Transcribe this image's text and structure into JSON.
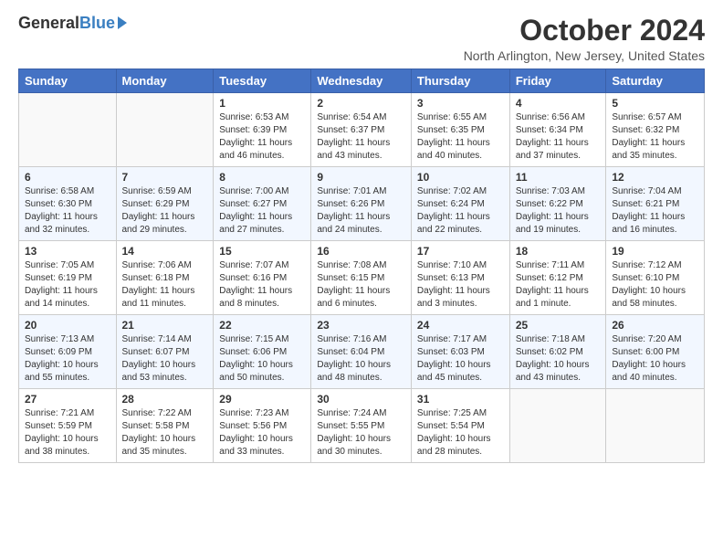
{
  "header": {
    "logo_general": "General",
    "logo_blue": "Blue",
    "title": "October 2024",
    "location": "North Arlington, New Jersey, United States"
  },
  "days_of_week": [
    "Sunday",
    "Monday",
    "Tuesday",
    "Wednesday",
    "Thursday",
    "Friday",
    "Saturday"
  ],
  "weeks": [
    [
      {
        "day": "",
        "info": ""
      },
      {
        "day": "",
        "info": ""
      },
      {
        "day": "1",
        "info": "Sunrise: 6:53 AM\nSunset: 6:39 PM\nDaylight: 11 hours and 46 minutes."
      },
      {
        "day": "2",
        "info": "Sunrise: 6:54 AM\nSunset: 6:37 PM\nDaylight: 11 hours and 43 minutes."
      },
      {
        "day": "3",
        "info": "Sunrise: 6:55 AM\nSunset: 6:35 PM\nDaylight: 11 hours and 40 minutes."
      },
      {
        "day": "4",
        "info": "Sunrise: 6:56 AM\nSunset: 6:34 PM\nDaylight: 11 hours and 37 minutes."
      },
      {
        "day": "5",
        "info": "Sunrise: 6:57 AM\nSunset: 6:32 PM\nDaylight: 11 hours and 35 minutes."
      }
    ],
    [
      {
        "day": "6",
        "info": "Sunrise: 6:58 AM\nSunset: 6:30 PM\nDaylight: 11 hours and 32 minutes."
      },
      {
        "day": "7",
        "info": "Sunrise: 6:59 AM\nSunset: 6:29 PM\nDaylight: 11 hours and 29 minutes."
      },
      {
        "day": "8",
        "info": "Sunrise: 7:00 AM\nSunset: 6:27 PM\nDaylight: 11 hours and 27 minutes."
      },
      {
        "day": "9",
        "info": "Sunrise: 7:01 AM\nSunset: 6:26 PM\nDaylight: 11 hours and 24 minutes."
      },
      {
        "day": "10",
        "info": "Sunrise: 7:02 AM\nSunset: 6:24 PM\nDaylight: 11 hours and 22 minutes."
      },
      {
        "day": "11",
        "info": "Sunrise: 7:03 AM\nSunset: 6:22 PM\nDaylight: 11 hours and 19 minutes."
      },
      {
        "day": "12",
        "info": "Sunrise: 7:04 AM\nSunset: 6:21 PM\nDaylight: 11 hours and 16 minutes."
      }
    ],
    [
      {
        "day": "13",
        "info": "Sunrise: 7:05 AM\nSunset: 6:19 PM\nDaylight: 11 hours and 14 minutes."
      },
      {
        "day": "14",
        "info": "Sunrise: 7:06 AM\nSunset: 6:18 PM\nDaylight: 11 hours and 11 minutes."
      },
      {
        "day": "15",
        "info": "Sunrise: 7:07 AM\nSunset: 6:16 PM\nDaylight: 11 hours and 8 minutes."
      },
      {
        "day": "16",
        "info": "Sunrise: 7:08 AM\nSunset: 6:15 PM\nDaylight: 11 hours and 6 minutes."
      },
      {
        "day": "17",
        "info": "Sunrise: 7:10 AM\nSunset: 6:13 PM\nDaylight: 11 hours and 3 minutes."
      },
      {
        "day": "18",
        "info": "Sunrise: 7:11 AM\nSunset: 6:12 PM\nDaylight: 11 hours and 1 minute."
      },
      {
        "day": "19",
        "info": "Sunrise: 7:12 AM\nSunset: 6:10 PM\nDaylight: 10 hours and 58 minutes."
      }
    ],
    [
      {
        "day": "20",
        "info": "Sunrise: 7:13 AM\nSunset: 6:09 PM\nDaylight: 10 hours and 55 minutes."
      },
      {
        "day": "21",
        "info": "Sunrise: 7:14 AM\nSunset: 6:07 PM\nDaylight: 10 hours and 53 minutes."
      },
      {
        "day": "22",
        "info": "Sunrise: 7:15 AM\nSunset: 6:06 PM\nDaylight: 10 hours and 50 minutes."
      },
      {
        "day": "23",
        "info": "Sunrise: 7:16 AM\nSunset: 6:04 PM\nDaylight: 10 hours and 48 minutes."
      },
      {
        "day": "24",
        "info": "Sunrise: 7:17 AM\nSunset: 6:03 PM\nDaylight: 10 hours and 45 minutes."
      },
      {
        "day": "25",
        "info": "Sunrise: 7:18 AM\nSunset: 6:02 PM\nDaylight: 10 hours and 43 minutes."
      },
      {
        "day": "26",
        "info": "Sunrise: 7:20 AM\nSunset: 6:00 PM\nDaylight: 10 hours and 40 minutes."
      }
    ],
    [
      {
        "day": "27",
        "info": "Sunrise: 7:21 AM\nSunset: 5:59 PM\nDaylight: 10 hours and 38 minutes."
      },
      {
        "day": "28",
        "info": "Sunrise: 7:22 AM\nSunset: 5:58 PM\nDaylight: 10 hours and 35 minutes."
      },
      {
        "day": "29",
        "info": "Sunrise: 7:23 AM\nSunset: 5:56 PM\nDaylight: 10 hours and 33 minutes."
      },
      {
        "day": "30",
        "info": "Sunrise: 7:24 AM\nSunset: 5:55 PM\nDaylight: 10 hours and 30 minutes."
      },
      {
        "day": "31",
        "info": "Sunrise: 7:25 AM\nSunset: 5:54 PM\nDaylight: 10 hours and 28 minutes."
      },
      {
        "day": "",
        "info": ""
      },
      {
        "day": "",
        "info": ""
      }
    ]
  ]
}
